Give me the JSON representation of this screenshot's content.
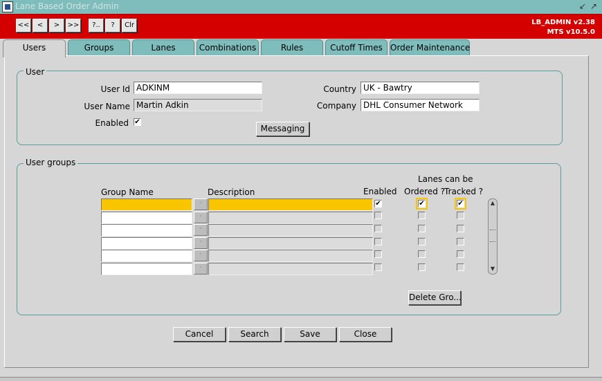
{
  "window": {
    "title": "Lane Based Order Admin",
    "controls": [
      "↙",
      "↗"
    ]
  },
  "toolbar": {
    "buttons": [
      {
        "label": "<<"
      },
      {
        "label": "<"
      },
      {
        "label": ">"
      },
      {
        "label": ">>"
      },
      {
        "label": "?.."
      },
      {
        "label": "?"
      },
      {
        "label": "Clr"
      }
    ],
    "version_line1": "LB_ADMIN v2.38",
    "version_line2": "MTS v10.5.0"
  },
  "tabs": [
    {
      "label": "Users"
    },
    {
      "label": "Groups"
    },
    {
      "label": "Lanes"
    },
    {
      "label": "Combinations"
    },
    {
      "label": "Rules"
    },
    {
      "label": "Cutoff Times"
    },
    {
      "label": "Order Maintenance"
    }
  ],
  "user_section": {
    "legend": "User",
    "user_id_label": "User Id",
    "user_id_value": "ADKINM",
    "user_name_label": "User Name",
    "user_name_value": "Martin Adkin",
    "enabled_label": "Enabled",
    "enabled_checked": true,
    "country_label": "Country",
    "country_value": "UK - Bawtry",
    "company_label": "Company",
    "company_value": "DHL Consumer Network",
    "messaging_button": "Messaging"
  },
  "groups_section": {
    "legend": "User groups",
    "col_group_name": "Group Name",
    "col_description": "Description",
    "col_enabled": "Enabled",
    "lanes_header": "Lanes can be",
    "col_ordered": "Ordered ?",
    "col_tracked": "Tracked ?",
    "rows": [
      {
        "group": "",
        "description": "",
        "enabled": true,
        "ordered": true,
        "tracked": true
      },
      {
        "group": "",
        "description": "",
        "enabled": false,
        "ordered": false,
        "tracked": false
      },
      {
        "group": "",
        "description": "",
        "enabled": false,
        "ordered": false,
        "tracked": false
      },
      {
        "group": "",
        "description": "",
        "enabled": false,
        "ordered": false,
        "tracked": false
      },
      {
        "group": "",
        "description": "",
        "enabled": false,
        "ordered": false,
        "tracked": false
      },
      {
        "group": "",
        "description": "",
        "enabled": false,
        "ordered": false,
        "tracked": false
      }
    ],
    "delete_button": "Delete Gro..."
  },
  "footer": {
    "cancel": "Cancel",
    "search": "Search",
    "save": "Save",
    "close": "Close"
  },
  "glyphs": {
    "check": "✔",
    "lov": "·",
    "scroll_up": "▲",
    "scroll_down": "▼"
  }
}
